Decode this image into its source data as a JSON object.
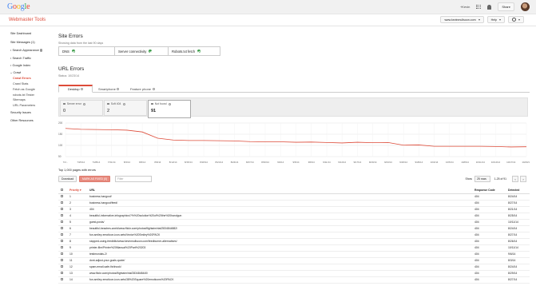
{
  "header": {
    "logo_letters": [
      {
        "ch": "G",
        "color": "#4285f4"
      },
      {
        "ch": "o",
        "color": "#ea4335"
      },
      {
        "ch": "o",
        "color": "#fbbc05"
      },
      {
        "ch": "g",
        "color": "#4285f4"
      },
      {
        "ch": "l",
        "color": "#34a853"
      },
      {
        "ch": "e",
        "color": "#ea4335"
      }
    ],
    "plus_label": "+Kevin",
    "share_label": "Share"
  },
  "subheader": {
    "product": "Webmaster Tools",
    "site": "www.kevinmullsoon.com",
    "help": "Help"
  },
  "sidebar": {
    "items": [
      {
        "label": "Site Dashboard",
        "child": false,
        "expand": "",
        "active": false
      },
      {
        "label": "Site Messages (1)",
        "child": false,
        "expand": "",
        "active": false
      },
      {
        "label": "Search Appearance",
        "child": false,
        "expand": "right",
        "active": false,
        "info": true
      },
      {
        "label": "Search Traffic",
        "child": false,
        "expand": "right",
        "active": false
      },
      {
        "label": "Google Index",
        "child": false,
        "expand": "right",
        "active": false
      },
      {
        "label": "Crawl",
        "child": false,
        "expand": "down",
        "active": false
      },
      {
        "label": "Crawl Errors",
        "child": true,
        "expand": "",
        "active": true
      },
      {
        "label": "Crawl Stats",
        "child": true,
        "expand": "",
        "active": false
      },
      {
        "label": "Fetch as Google",
        "child": true,
        "expand": "",
        "active": false
      },
      {
        "label": "robots.txt Tester",
        "child": true,
        "expand": "",
        "active": false
      },
      {
        "label": "Sitemaps",
        "child": true,
        "expand": "",
        "active": false
      },
      {
        "label": "URL Parameters",
        "child": true,
        "expand": "",
        "active": false
      },
      {
        "label": "Security Issues",
        "child": false,
        "expand": "",
        "active": false
      },
      {
        "label": "Other Resources",
        "child": false,
        "expand": "",
        "active": false
      }
    ]
  },
  "site_errors": {
    "title": "Site Errors",
    "subtitle": "Showing data from the last 90 days",
    "cells": [
      "DNS",
      "Server connectivity",
      "Robots.txt fetch"
    ]
  },
  "url_errors": {
    "title": "URL Errors",
    "status": "Status: 10/23/14",
    "tabs": [
      "Desktop",
      "Smartphone",
      "Feature phone"
    ],
    "counters": [
      {
        "label": "Server error",
        "value": "0"
      },
      {
        "label": "Soft 404",
        "value": "2"
      },
      {
        "label": "Not found",
        "value": "91"
      }
    ]
  },
  "chart_data": {
    "type": "line",
    "y_ticks": [
      "200",
      "150",
      "100",
      "50"
    ],
    "ylim": [
      50,
      200
    ],
    "x": [
      "7/2...",
      "7/25/14",
      "7/28/14",
      "7/31/14",
      "8/3/14",
      "8/6/14",
      "8/9/14",
      "8/12/14",
      "8/15/14",
      "8/18/14",
      "8/21/14",
      "8/24/14",
      "8/27/14",
      "8/30/14",
      "9/2/14",
      "9/5/14",
      "9/8/14",
      "9/11/14",
      "9/14/14",
      "9/17/14",
      "9/20/14",
      "9/23/14",
      "9/26/14",
      "9/29/14",
      "10/2/14",
      "10/5/14",
      "10/8/14",
      "10/11/14",
      "10/14/14",
      "10/17/14",
      "10/20/14"
    ],
    "series": [
      {
        "values": [
          176,
          172,
          171,
          170,
          168,
          160,
          132,
          124,
          122,
          122,
          121,
          120,
          117,
          116,
          116,
          114,
          115,
          113,
          111,
          114,
          112,
          113,
          101,
          102,
          96,
          96,
          96,
          96,
          95,
          93,
          94
        ]
      }
    ],
    "color": "#dd4b39",
    "grid": true
  },
  "table": {
    "summary": "Top 1,000 pages with errors",
    "download": "Download",
    "mark_fixed": "MARK AS FIXED (0)",
    "filter_placeholder": "Filter",
    "show_label": "Show",
    "rows_label": "25 rows",
    "range_label": "1-25 of 91",
    "headers": [
      "Priority",
      "URL",
      "Response Code",
      "Detected"
    ],
    "rows": [
      {
        "p": "1",
        "url": "business-hangout/",
        "code": "404",
        "date": "8/24/14"
      },
      {
        "p": "2",
        "url": "business-hangout/feed/",
        "code": "404",
        "date": "8/27/14"
      },
      {
        "p": "3",
        "url": "404",
        "code": "404",
        "date": "8/21/14"
      },
      {
        "p": "4",
        "url": "beautiful-informative-infographics/?%%20solution%20of%20the%20handgun",
        "code": "404",
        "date": "8/25/14"
      },
      {
        "p": "5",
        "url": "guest-posts/",
        "code": "404",
        "date": "10/11/14"
      },
      {
        "p": "6",
        "url": "beautiful-beaches-world/www.flickr.com/photos/flightaim/rial/2834844882/",
        "code": "404",
        "date": "8/24/14"
      },
      {
        "p": "7",
        "url": "fun-smiley-emoticon-icon-sets/Vector%20Smiley%20PACK",
        "code": "404",
        "date": "8/27/14"
      },
      {
        "p": "8",
        "url": "stopped-using-feedblitz/www.kevinmullsoon.com/feedburner-alternatives/",
        "code": "404",
        "date": "8/26/14"
      },
      {
        "p": "9",
        "url": "printer-film/Printer%20Manual%20Part%20203",
        "code": "404",
        "date": "10/11/14"
      },
      {
        "p": "10",
        "url": "testimonials-2/",
        "code": "404",
        "date": "9/6/14"
      },
      {
        "p": "11",
        "url": "dont-adjust-your-goals-quote/",
        "code": "404",
        "date": "8/3/14"
      },
      {
        "p": "12",
        "url": "spam-email-safe-fishhook/",
        "code": "404",
        "date": "8/24/14"
      },
      {
        "p": "13",
        "url": "www.flickr.com/photos/flightaim/rial/2834848440/",
        "code": "404",
        "date": "8/29/14"
      },
      {
        "p": "14",
        "url": "fun-smiley-emoticon-icon-sets/38%20Square%20emoticons%20PACK",
        "code": "404",
        "date": "8/27/14"
      }
    ]
  }
}
